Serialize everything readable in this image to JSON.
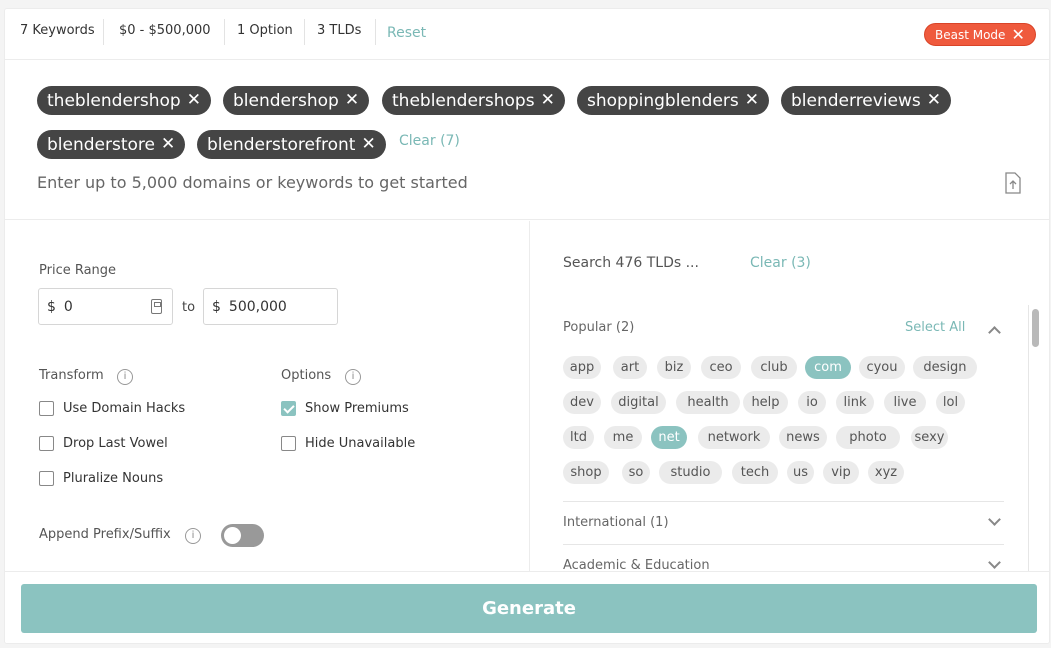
{
  "summary": {
    "keywords": "7 Keywords",
    "price": "$0 - $500,000",
    "options": "1 Option",
    "tlds": "3 TLDs",
    "reset": "Reset",
    "beast_mode": "Beast Mode"
  },
  "keywords": {
    "chips": [
      "theblendershop",
      "blendershop",
      "theblendershops",
      "shoppingblenders",
      "blenderreviews",
      "blenderstore",
      "blenderstorefront"
    ],
    "clear": "Clear (7)",
    "placeholder": "Enter up to 5,000 domains or keywords to get started"
  },
  "price_range": {
    "label": "Price Range",
    "currency": "$",
    "min": "0",
    "to": "to",
    "max": "500,000"
  },
  "transform": {
    "label": "Transform",
    "items": [
      {
        "label": "Use Domain Hacks",
        "checked": false
      },
      {
        "label": "Drop Last Vowel",
        "checked": false
      },
      {
        "label": "Pluralize Nouns",
        "checked": false
      }
    ]
  },
  "options": {
    "label": "Options",
    "items": [
      {
        "label": "Show Premiums",
        "checked": true
      },
      {
        "label": "Hide Unavailable",
        "checked": false
      }
    ]
  },
  "append": {
    "label": "Append Prefix/Suffix",
    "enabled": false
  },
  "tld_panel": {
    "search_placeholder": "Search 476 TLDs ...",
    "clear": "Clear (3)",
    "popular": {
      "title": "Popular (2)",
      "select_all": "Select All",
      "tlds": [
        {
          "name": "app",
          "selected": false
        },
        {
          "name": "art",
          "selected": false
        },
        {
          "name": "biz",
          "selected": false
        },
        {
          "name": "ceo",
          "selected": false
        },
        {
          "name": "club",
          "selected": false
        },
        {
          "name": "com",
          "selected": true
        },
        {
          "name": "cyou",
          "selected": false
        },
        {
          "name": "design",
          "selected": false
        },
        {
          "name": "dev",
          "selected": false
        },
        {
          "name": "digital",
          "selected": false
        },
        {
          "name": "health",
          "selected": false
        },
        {
          "name": "help",
          "selected": false
        },
        {
          "name": "io",
          "selected": false
        },
        {
          "name": "link",
          "selected": false
        },
        {
          "name": "live",
          "selected": false
        },
        {
          "name": "lol",
          "selected": false
        },
        {
          "name": "ltd",
          "selected": false
        },
        {
          "name": "me",
          "selected": false
        },
        {
          "name": "net",
          "selected": true
        },
        {
          "name": "network",
          "selected": false
        },
        {
          "name": "news",
          "selected": false
        },
        {
          "name": "photo",
          "selected": false
        },
        {
          "name": "sexy",
          "selected": false
        },
        {
          "name": "shop",
          "selected": false
        },
        {
          "name": "so",
          "selected": false
        },
        {
          "name": "studio",
          "selected": false
        },
        {
          "name": "tech",
          "selected": false
        },
        {
          "name": "us",
          "selected": false
        },
        {
          "name": "vip",
          "selected": false
        },
        {
          "name": "xyz",
          "selected": false
        }
      ]
    },
    "categories": [
      "International (1)",
      "Academic & Education"
    ]
  },
  "generate": "Generate",
  "colors": {
    "accent": "#8bc3c0",
    "link": "#7ab8b5",
    "beast": "#ef5a3d",
    "chip": "#454545"
  }
}
